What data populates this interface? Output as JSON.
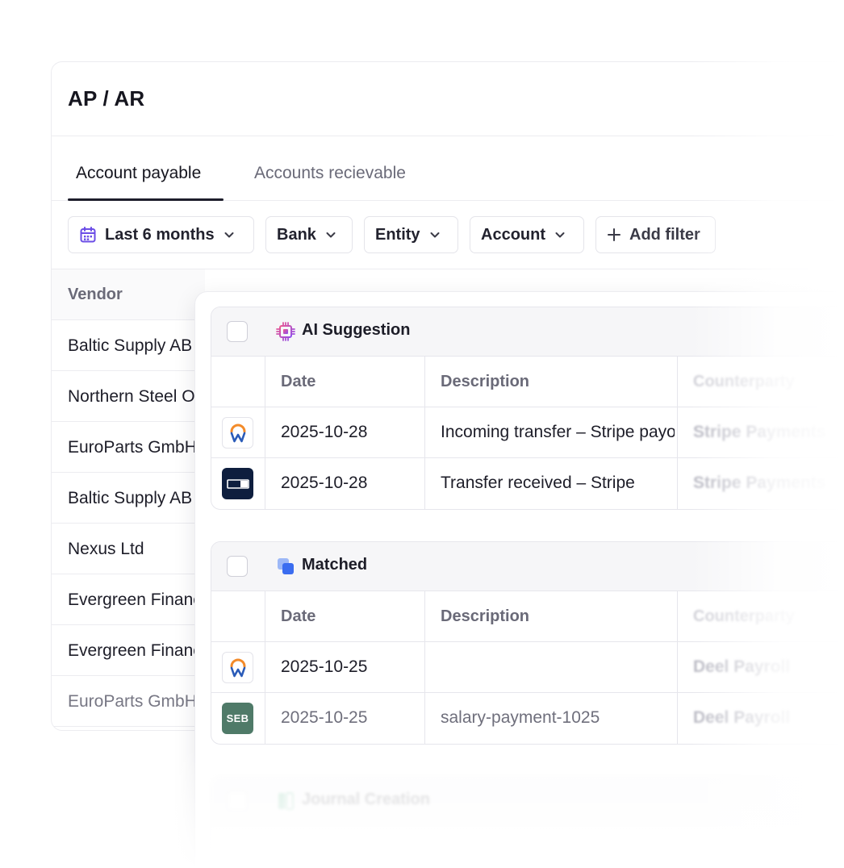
{
  "page": {
    "title": "AP / AR"
  },
  "tabs": [
    {
      "label": "Account payable",
      "active": true
    },
    {
      "label": "Accounts recievable",
      "active": false
    }
  ],
  "filters": {
    "date": "Last 6 months",
    "bank": "Bank",
    "entity": "Entity",
    "account": "Account",
    "add": "Add filter"
  },
  "vendors": {
    "header": "Vendor",
    "rows": [
      "Baltic Supply AB",
      "Northern Steel Oy",
      "EuroParts GmbH",
      "Baltic Supply AB",
      "Nexus Ltd",
      "Evergreen Finance",
      "Evergreen Finance",
      "EuroParts GmbH"
    ]
  },
  "ai_section": {
    "title": "AI Suggestion",
    "columns": {
      "date": "Date",
      "description": "Description",
      "counterparty": "Counterparty"
    },
    "rows": [
      {
        "logo": "workday-logo",
        "date": "2025-10-28",
        "description": "Incoming transfer – Stripe payout",
        "counterparty": "Stripe Payments"
      },
      {
        "logo": "bank-card-logo",
        "date": "2025-10-28",
        "description": "Transfer received – Stripe",
        "counterparty": "Stripe Payments"
      }
    ]
  },
  "matched_section": {
    "title": "Matched",
    "columns": {
      "date": "Date",
      "description": "Description",
      "counterparty": "Counterparty"
    },
    "rows": [
      {
        "logo": "workday-logo",
        "date": "2025-10-25",
        "description": "",
        "counterparty": "Deel Payroll"
      },
      {
        "logo": "seb-logo",
        "logo_text": "SEB",
        "date": "2025-10-25",
        "description": "salary-payment-1025",
        "counterparty": "Deel Payroll"
      }
    ]
  },
  "journal_section": {
    "title": "Journal Creation"
  },
  "colors": {
    "accent_purple": "#6b4de6",
    "matched_blue": "#3b6df0",
    "journal_green": "#3aa876",
    "bank_navy": "#0e1e3e",
    "seb_green": "#4f7a68"
  }
}
